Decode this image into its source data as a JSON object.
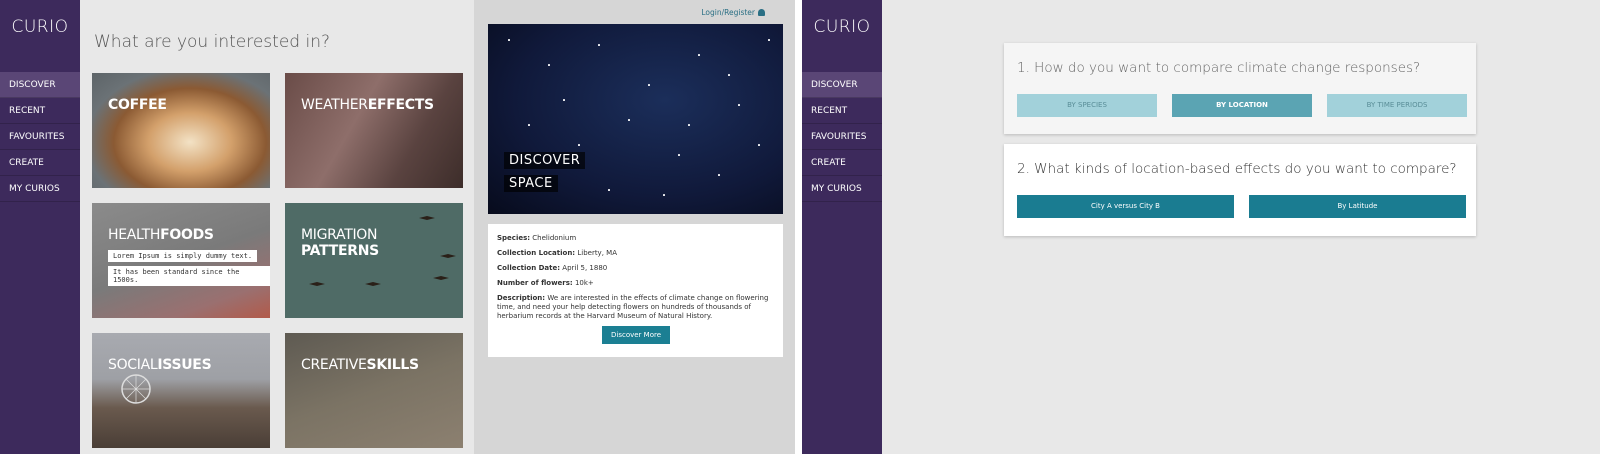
{
  "app": {
    "logo": "CURIO"
  },
  "sidebar": {
    "items": [
      {
        "label": "DISCOVER",
        "active": true
      },
      {
        "label": "RECENT"
      },
      {
        "label": "FAVOURITES"
      },
      {
        "label": "CREATE"
      },
      {
        "label": "MY CURIOS"
      }
    ]
  },
  "discover_page": {
    "heading": "What are you interested in?",
    "tiles": {
      "coffee": {
        "bold": "COFFEE",
        "light": ""
      },
      "weather": {
        "light": "WEATHER",
        "bold": "EFFECTS"
      },
      "health": {
        "light": "HEALTH",
        "bold": "FOODS",
        "captions": [
          "Lorem Ipsum is simply dummy text.",
          "It has been standard since the 1500s."
        ]
      },
      "migration": {
        "light": "MIGRATION",
        "bold": "PATTERNS"
      },
      "social": {
        "light": "SOCIAL",
        "bold": "ISSUES"
      },
      "creative": {
        "light": "CREATIVE",
        "bold": "SKILLS"
      }
    },
    "login": "Login/Register",
    "feature": {
      "line1": "DISCOVER",
      "line2": "SPACE"
    },
    "info": {
      "species_label": "Species:",
      "species": "Chelidonium",
      "location_label": "Collection Location:",
      "location": "Liberty, MA",
      "date_label": "Collection Date:",
      "date": "April 5, 1880",
      "flowers_label": "Number of flowers:",
      "flowers": "10k+",
      "desc_label": "Description:",
      "desc": "We are interested in the effects of climate change on flowering time, and need your help detecting flowers on hundreds of thousands of herbarium records at the Harvard Museum of Natural History.",
      "button": "Discover More"
    }
  },
  "compare_page": {
    "q1": "1. How do you want to compare climate change responses?",
    "q1_options": [
      "BY SPECIES",
      "BY LOCATION",
      "BY TIME PERIODS"
    ],
    "q1_selected": "BY LOCATION",
    "q2": "2. What kinds of location-based effects do you want to compare?",
    "q2_options": [
      "City A versus City B",
      "By Latitude"
    ]
  },
  "colors": {
    "sidebar": "#3d2a5c",
    "sidebar_active": "#5a4676",
    "accent": "#1a7c91",
    "option_light": "#a2d1da",
    "option_selected": "#5ba4b3"
  }
}
